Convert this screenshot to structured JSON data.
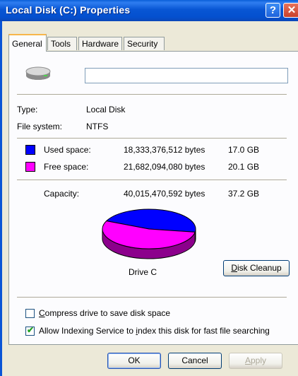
{
  "window": {
    "title": "Local Disk (C:) Properties"
  },
  "tabs": [
    {
      "label": "General",
      "active": true
    },
    {
      "label": "Tools",
      "active": false
    },
    {
      "label": "Hardware",
      "active": false
    },
    {
      "label": "Security",
      "active": false
    }
  ],
  "drive": {
    "name_value": "",
    "icon": "hard-drive-icon"
  },
  "info": {
    "type_label": "Type:",
    "type_value": "Local Disk",
    "fs_label": "File system:",
    "fs_value": "NTFS"
  },
  "space": {
    "used": {
      "label": "Used space:",
      "bytes": "18,333,376,512 bytes",
      "size": "17.0 GB",
      "color": "#0000ff"
    },
    "free": {
      "label": "Free space:",
      "bytes": "21,682,094,080 bytes",
      "size": "20.1 GB",
      "color": "#ff00ff"
    },
    "capacity": {
      "label": "Capacity:",
      "bytes": "40,015,470,592 bytes",
      "size": "37.2 GB"
    }
  },
  "chart_data": {
    "type": "pie",
    "categories": [
      "Used space",
      "Free space"
    ],
    "values": [
      18333376512,
      21682094080
    ],
    "colors": [
      "#0000ff",
      "#ff00ff"
    ],
    "label": "Drive C"
  },
  "disk_cleanup": {
    "prefix": "D",
    "rest": "isk Cleanup"
  },
  "options": {
    "compress": {
      "prefix": "C",
      "rest": "ompress drive to save disk space",
      "checked": false
    },
    "index": {
      "part1": "Allow Indexing Service to ",
      "underline": "i",
      "part2": "ndex this disk for fast file searching",
      "checked": true
    }
  },
  "footer": {
    "ok": "OK",
    "cancel": "Cancel",
    "apply": "Apply",
    "apply_prefix": "A",
    "apply_rest": "pply"
  }
}
